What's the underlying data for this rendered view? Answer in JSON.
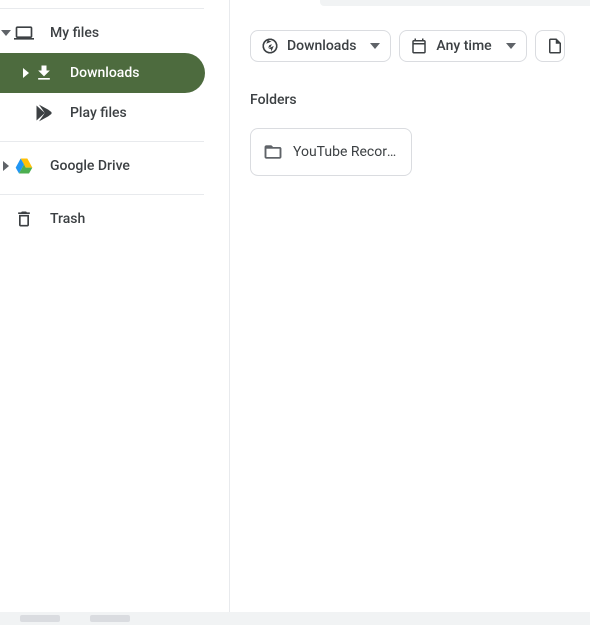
{
  "sidebar": {
    "my_files": {
      "label": "My files"
    },
    "downloads": {
      "label": "Downloads"
    },
    "play_files": {
      "label": "Play files"
    },
    "google_drive": {
      "label": "Google Drive"
    },
    "trash": {
      "label": "Trash"
    }
  },
  "filters": {
    "location": {
      "label": "Downloads"
    },
    "time": {
      "label": "Any time"
    }
  },
  "main": {
    "folders_header": "Folders",
    "folders": [
      {
        "label": "YouTube Record…"
      }
    ]
  }
}
